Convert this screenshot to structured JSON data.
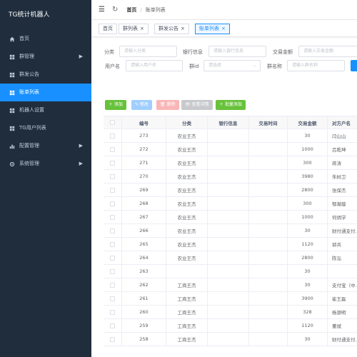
{
  "sidebar": {
    "title": "TG统计机器人",
    "items": [
      {
        "label": "首页",
        "icon": "home-icon",
        "arrow": false,
        "active": false
      },
      {
        "label": "群管理",
        "icon": "grid-icon",
        "arrow": true,
        "active": false
      },
      {
        "label": "群发公告",
        "icon": "grid-icon",
        "arrow": false,
        "active": false
      },
      {
        "label": "账单列表",
        "icon": "grid-icon",
        "arrow": false,
        "active": true
      },
      {
        "label": "机器人设置",
        "icon": "grid-icon",
        "arrow": false,
        "active": false
      },
      {
        "label": "TG用户列表",
        "icon": "grid-icon",
        "arrow": false,
        "active": false
      },
      {
        "label": "配置管理",
        "icon": "bar-chart-icon",
        "arrow": true,
        "active": false
      },
      {
        "label": "系统管理",
        "icon": "gear-icon",
        "arrow": true,
        "active": false
      }
    ],
    "arrow_glyph": "▶"
  },
  "header": {
    "hamburger_glyph": "☰",
    "refresh_glyph": "↻",
    "breadcrumb_home": "首页",
    "breadcrumb_sep": "/",
    "breadcrumb_current": "账单列表"
  },
  "tags": [
    {
      "label": "首页",
      "closable": false,
      "active": false
    },
    {
      "label": "群列表",
      "closable": true,
      "active": false
    },
    {
      "label": "群发公告",
      "closable": true,
      "active": false
    },
    {
      "label": "账单列表",
      "closable": true,
      "active": true
    }
  ],
  "tag_close_glyph": "×",
  "search": {
    "category_label": "分类",
    "category_placeholder": "请输入分类",
    "bank_label": "银行信息",
    "bank_placeholder": "请输入银行信息",
    "amount_label": "交易金额",
    "amount_placeholder": "请输入交易金额",
    "username_label": "用户名",
    "username_placeholder": "请输入用户名",
    "group_label": "群id",
    "group_placeholder": "请选择",
    "groupname_label": "群名称",
    "groupname_placeholder": "请输入群名称",
    "select_arrow": "⌄"
  },
  "toolbar": {
    "add_label": "＋ 添加",
    "edit_label": "✎ 修改",
    "delete_label": "🗑 删除",
    "view_label": "👁 查看详情",
    "batch_label": "＋ 批量添加"
  },
  "table": {
    "columns": [
      "编号",
      "分类",
      "银行信息",
      "交易时间",
      "交易金额",
      "对方户名"
    ],
    "rows": [
      {
        "id": "273",
        "category": "农业王杰",
        "bank": "",
        "time": "",
        "amount": "30",
        "name": "闫山山"
      },
      {
        "id": "272",
        "category": "农业王杰",
        "bank": "",
        "time": "",
        "amount": "1000",
        "name": "吕乾坤"
      },
      {
        "id": "271",
        "category": "农业王杰",
        "bank": "",
        "time": "",
        "amount": "300",
        "name": "蒋涛"
      },
      {
        "id": "270",
        "category": "农业王杰",
        "bank": "",
        "time": "",
        "amount": "3980",
        "name": "朱树卫"
      },
      {
        "id": "269",
        "category": "农业王杰",
        "bank": "",
        "time": "",
        "amount": "2800",
        "name": "张保杰"
      },
      {
        "id": "268",
        "category": "农业王杰",
        "bank": "",
        "time": "",
        "amount": "300",
        "name": "郁瀚璇"
      },
      {
        "id": "267",
        "category": "农业王杰",
        "bank": "",
        "time": "",
        "amount": "1000",
        "name": "何炳学"
      },
      {
        "id": "266",
        "category": "农业王杰",
        "bank": "",
        "time": "",
        "amount": "30",
        "name": "财付通支付..."
      },
      {
        "id": "265",
        "category": "农业王杰",
        "bank": "",
        "time": "",
        "amount": "1120",
        "name": "郭兵"
      },
      {
        "id": "264",
        "category": "农业王杰",
        "bank": "",
        "time": "",
        "amount": "2800",
        "name": "陈泓"
      },
      {
        "id": "263",
        "category": "",
        "bank": "",
        "time": "",
        "amount": "30",
        "name": ""
      },
      {
        "id": "262",
        "category": "工商王杰",
        "bank": "",
        "time": "",
        "amount": "30",
        "name": "支付宝（中..."
      },
      {
        "id": "261",
        "category": "工商王杰",
        "bank": "",
        "time": "",
        "amount": "3900",
        "name": "崔王磊"
      },
      {
        "id": "260",
        "category": "工商王杰",
        "bank": "",
        "time": "",
        "amount": "328",
        "name": "杨源明"
      },
      {
        "id": "259",
        "category": "工商王杰",
        "bank": "",
        "time": "",
        "amount": "1120",
        "name": "董斌"
      },
      {
        "id": "258",
        "category": "工商王杰",
        "bank": "",
        "time": "",
        "amount": "30",
        "name": "财付通支付..."
      }
    ]
  },
  "colors": {
    "sidebar_bg": "#1f2d3d",
    "accent": "#1890ff",
    "success": "#67c23a"
  }
}
